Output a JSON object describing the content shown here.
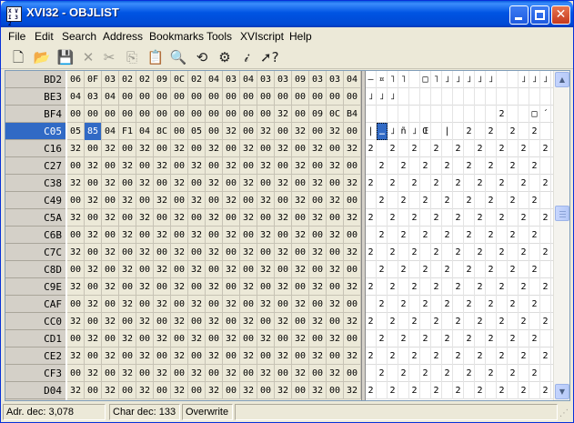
{
  "window": {
    "title": "XVI32 - OBJLIST",
    "icon_text": "X V I 3 2"
  },
  "menu": [
    "File",
    "Edit",
    "Search",
    "Address",
    "Bookmarks",
    "Tools",
    "XVIscript",
    "Help"
  ],
  "toolbar": {
    "icons": [
      {
        "name": "new-file-icon",
        "glyph": "🗋",
        "enabled": true
      },
      {
        "name": "open-folder-icon",
        "glyph": "📂",
        "enabled": true
      },
      {
        "name": "save-icon",
        "glyph": "💾",
        "enabled": true
      },
      {
        "name": "close-file-icon",
        "glyph": "✕",
        "enabled": false
      },
      {
        "name": "cut-icon",
        "glyph": "✂",
        "enabled": false
      },
      {
        "name": "copy-icon",
        "glyph": "⎘",
        "enabled": false
      },
      {
        "name": "paste-icon",
        "glyph": "📋",
        "enabled": false
      },
      {
        "name": "find-icon",
        "glyph": "🔍",
        "enabled": true
      },
      {
        "name": "replace-icon",
        "glyph": "⟲",
        "enabled": true
      },
      {
        "name": "goto-icon",
        "glyph": "⚙",
        "enabled": true
      },
      {
        "name": "info-icon",
        "glyph": "𝒾",
        "enabled": true
      },
      {
        "name": "context-help-icon",
        "glyph": "➚?",
        "enabled": true
      }
    ]
  },
  "editor": {
    "selected_row": 3,
    "selected_col": 1,
    "rows": [
      {
        "addr": "BD2",
        "hex": [
          "06",
          "0F",
          "03",
          "02",
          "02",
          "09",
          "0C",
          "02",
          "04",
          "03",
          "04",
          "03",
          "03",
          "09",
          "03",
          "03",
          "04"
        ],
        "chars": [
          "–",
          "¤",
          "˥",
          "˥",
          "",
          "□",
          "˥",
          "˩",
          "˩",
          "˩",
          "˩",
          "˩",
          "",
          "",
          "˩",
          "˩",
          "˩"
        ]
      },
      {
        "addr": "BE3",
        "hex": [
          "04",
          "03",
          "04",
          "00",
          "00",
          "00",
          "00",
          "00",
          "00",
          "00",
          "00",
          "00",
          "00",
          "00",
          "00",
          "00",
          "00"
        ],
        "chars": [
          "˩",
          "˩",
          "˩",
          "",
          "",
          "",
          "",
          "",
          "",
          "",
          "",
          "",
          "",
          "",
          "",
          "",
          ""
        ]
      },
      {
        "addr": "BF4",
        "hex": [
          "00",
          "00",
          "00",
          "00",
          "00",
          "00",
          "00",
          "00",
          "00",
          "00",
          "00",
          "00",
          "32",
          "00",
          "09",
          "0C",
          "B4"
        ],
        "chars": [
          "",
          "",
          "",
          "",
          "",
          "",
          "",
          "",
          "",
          "",
          "",
          "",
          "2",
          "",
          "",
          "□",
          "´"
        ]
      },
      {
        "addr": "C05",
        "hex": [
          "05",
          "85",
          "04",
          "F1",
          "04",
          "8C",
          "00",
          "05",
          "00",
          "32",
          "00",
          "32",
          "00",
          "32",
          "00",
          "32",
          "00"
        ],
        "chars": [
          "|",
          "…",
          "˩",
          "ñ",
          "˩",
          "Œ",
          "",
          "|",
          "",
          "2",
          "",
          "2",
          "",
          "2",
          "",
          "2",
          ""
        ]
      },
      {
        "addr": "C16",
        "hex": [
          "32",
          "00",
          "32",
          "00",
          "32",
          "00",
          "32",
          "00",
          "32",
          "00",
          "32",
          "00",
          "32",
          "00",
          "32",
          "00",
          "32"
        ],
        "chars": [
          "2",
          "",
          "2",
          "",
          "2",
          "",
          "2",
          "",
          "2",
          "",
          "2",
          "",
          "2",
          "",
          "2",
          "",
          "2"
        ]
      },
      {
        "addr": "C27",
        "hex": [
          "00",
          "32",
          "00",
          "32",
          "00",
          "32",
          "00",
          "32",
          "00",
          "32",
          "00",
          "32",
          "00",
          "32",
          "00",
          "32",
          "00"
        ],
        "chars": [
          "",
          "2",
          "",
          "2",
          "",
          "2",
          "",
          "2",
          "",
          "2",
          "",
          "2",
          "",
          "2",
          "",
          "2",
          ""
        ]
      },
      {
        "addr": "C38",
        "hex": [
          "32",
          "00",
          "32",
          "00",
          "32",
          "00",
          "32",
          "00",
          "32",
          "00",
          "32",
          "00",
          "32",
          "00",
          "32",
          "00",
          "32"
        ],
        "chars": [
          "2",
          "",
          "2",
          "",
          "2",
          "",
          "2",
          "",
          "2",
          "",
          "2",
          "",
          "2",
          "",
          "2",
          "",
          "2"
        ]
      },
      {
        "addr": "C49",
        "hex": [
          "00",
          "32",
          "00",
          "32",
          "00",
          "32",
          "00",
          "32",
          "00",
          "32",
          "00",
          "32",
          "00",
          "32",
          "00",
          "32",
          "00"
        ],
        "chars": [
          "",
          "2",
          "",
          "2",
          "",
          "2",
          "",
          "2",
          "",
          "2",
          "",
          "2",
          "",
          "2",
          "",
          "2",
          ""
        ]
      },
      {
        "addr": "C5A",
        "hex": [
          "32",
          "00",
          "32",
          "00",
          "32",
          "00",
          "32",
          "00",
          "32",
          "00",
          "32",
          "00",
          "32",
          "00",
          "32",
          "00",
          "32"
        ],
        "chars": [
          "2",
          "",
          "2",
          "",
          "2",
          "",
          "2",
          "",
          "2",
          "",
          "2",
          "",
          "2",
          "",
          "2",
          "",
          "2"
        ]
      },
      {
        "addr": "C6B",
        "hex": [
          "00",
          "32",
          "00",
          "32",
          "00",
          "32",
          "00",
          "32",
          "00",
          "32",
          "00",
          "32",
          "00",
          "32",
          "00",
          "32",
          "00"
        ],
        "chars": [
          "",
          "2",
          "",
          "2",
          "",
          "2",
          "",
          "2",
          "",
          "2",
          "",
          "2",
          "",
          "2",
          "",
          "2",
          ""
        ]
      },
      {
        "addr": "C7C",
        "hex": [
          "32",
          "00",
          "32",
          "00",
          "32",
          "00",
          "32",
          "00",
          "32",
          "00",
          "32",
          "00",
          "32",
          "00",
          "32",
          "00",
          "32"
        ],
        "chars": [
          "2",
          "",
          "2",
          "",
          "2",
          "",
          "2",
          "",
          "2",
          "",
          "2",
          "",
          "2",
          "",
          "2",
          "",
          "2"
        ]
      },
      {
        "addr": "C8D",
        "hex": [
          "00",
          "32",
          "00",
          "32",
          "00",
          "32",
          "00",
          "32",
          "00",
          "32",
          "00",
          "32",
          "00",
          "32",
          "00",
          "32",
          "00"
        ],
        "chars": [
          "",
          "2",
          "",
          "2",
          "",
          "2",
          "",
          "2",
          "",
          "2",
          "",
          "2",
          "",
          "2",
          "",
          "2",
          ""
        ]
      },
      {
        "addr": "C9E",
        "hex": [
          "32",
          "00",
          "32",
          "00",
          "32",
          "00",
          "32",
          "00",
          "32",
          "00",
          "32",
          "00",
          "32",
          "00",
          "32",
          "00",
          "32"
        ],
        "chars": [
          "2",
          "",
          "2",
          "",
          "2",
          "",
          "2",
          "",
          "2",
          "",
          "2",
          "",
          "2",
          "",
          "2",
          "",
          "2"
        ]
      },
      {
        "addr": "CAF",
        "hex": [
          "00",
          "32",
          "00",
          "32",
          "00",
          "32",
          "00",
          "32",
          "00",
          "32",
          "00",
          "32",
          "00",
          "32",
          "00",
          "32",
          "00"
        ],
        "chars": [
          "",
          "2",
          "",
          "2",
          "",
          "2",
          "",
          "2",
          "",
          "2",
          "",
          "2",
          "",
          "2",
          "",
          "2",
          ""
        ]
      },
      {
        "addr": "CC0",
        "hex": [
          "32",
          "00",
          "32",
          "00",
          "32",
          "00",
          "32",
          "00",
          "32",
          "00",
          "32",
          "00",
          "32",
          "00",
          "32",
          "00",
          "32"
        ],
        "chars": [
          "2",
          "",
          "2",
          "",
          "2",
          "",
          "2",
          "",
          "2",
          "",
          "2",
          "",
          "2",
          "",
          "2",
          "",
          "2"
        ]
      },
      {
        "addr": "CD1",
        "hex": [
          "00",
          "32",
          "00",
          "32",
          "00",
          "32",
          "00",
          "32",
          "00",
          "32",
          "00",
          "32",
          "00",
          "32",
          "00",
          "32",
          "00"
        ],
        "chars": [
          "",
          "2",
          "",
          "2",
          "",
          "2",
          "",
          "2",
          "",
          "2",
          "",
          "2",
          "",
          "2",
          "",
          "2",
          ""
        ]
      },
      {
        "addr": "CE2",
        "hex": [
          "32",
          "00",
          "32",
          "00",
          "32",
          "00",
          "32",
          "00",
          "32",
          "00",
          "32",
          "00",
          "32",
          "00",
          "32",
          "00",
          "32"
        ],
        "chars": [
          "2",
          "",
          "2",
          "",
          "2",
          "",
          "2",
          "",
          "2",
          "",
          "2",
          "",
          "2",
          "",
          "2",
          "",
          "2"
        ]
      },
      {
        "addr": "CF3",
        "hex": [
          "00",
          "32",
          "00",
          "32",
          "00",
          "32",
          "00",
          "32",
          "00",
          "32",
          "00",
          "32",
          "00",
          "32",
          "00",
          "32",
          "00"
        ],
        "chars": [
          "",
          "2",
          "",
          "2",
          "",
          "2",
          "",
          "2",
          "",
          "2",
          "",
          "2",
          "",
          "2",
          "",
          "2",
          ""
        ]
      },
      {
        "addr": "D04",
        "hex": [
          "32",
          "00",
          "32",
          "00",
          "32",
          "00",
          "32",
          "00",
          "32",
          "00",
          "32",
          "00",
          "32",
          "00",
          "32",
          "00",
          "32"
        ],
        "chars": [
          "2",
          "",
          "2",
          "",
          "2",
          "",
          "2",
          "",
          "2",
          "",
          "2",
          "",
          "2",
          "",
          "2",
          "",
          "2"
        ]
      }
    ]
  },
  "scrollbar": {
    "up_glyph": "▲",
    "down_glyph": "▼"
  },
  "status": {
    "address": "Adr. dec: 3,078",
    "char": "Char dec: 133",
    "mode": "Overwrite"
  }
}
